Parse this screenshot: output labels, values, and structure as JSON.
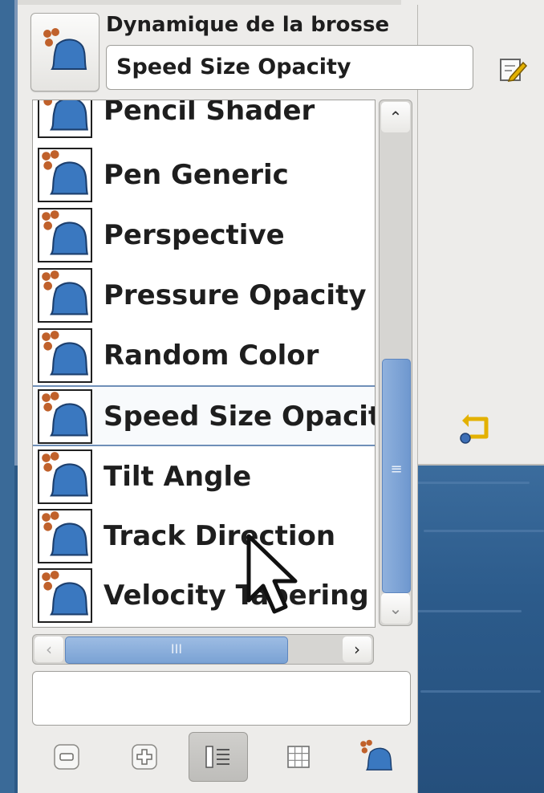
{
  "header": {
    "title": "Dynamique de la brosse",
    "selected_dynamics": "Speed Size Opacity"
  },
  "list": {
    "items": [
      {
        "label": "Pencil Shader"
      },
      {
        "label": "Pen Generic"
      },
      {
        "label": "Perspective"
      },
      {
        "label": "Pressure Opacity"
      },
      {
        "label": "Random Color"
      },
      {
        "label": "Speed Size Opacit"
      },
      {
        "label": "Tilt Angle"
      },
      {
        "label": "Track Direction"
      },
      {
        "label": "Velocity Tapering"
      }
    ],
    "selected_index": 5
  },
  "filter": {
    "value": ""
  },
  "toolbar": {
    "buttons": [
      {
        "icon": "minus-icon"
      },
      {
        "icon": "plus-icon"
      },
      {
        "icon": "list-view-icon"
      },
      {
        "icon": "grid-view-icon"
      },
      {
        "icon": "dynamics-icon"
      }
    ],
    "active_index": 2
  },
  "colors": {
    "accent": "#6f98cf",
    "dynamics_icon_blue": "#3a78c0",
    "dynamics_icon_orange": "#c0612b"
  }
}
